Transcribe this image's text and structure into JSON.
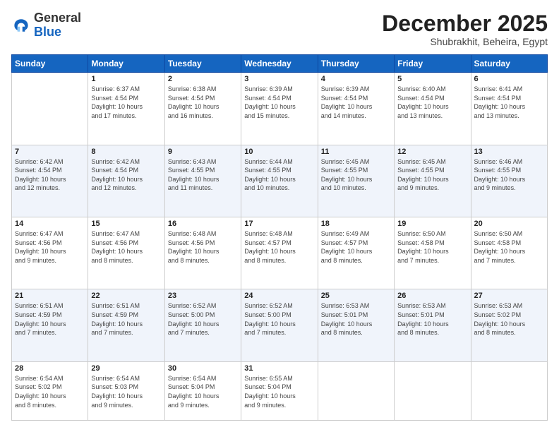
{
  "logo": {
    "general": "General",
    "blue": "Blue"
  },
  "header": {
    "month": "December 2025",
    "location": "Shubrakhit, Beheira, Egypt"
  },
  "weekdays": [
    "Sunday",
    "Monday",
    "Tuesday",
    "Wednesday",
    "Thursday",
    "Friday",
    "Saturday"
  ],
  "weeks": [
    [
      {
        "day": "",
        "info": ""
      },
      {
        "day": "1",
        "info": "Sunrise: 6:37 AM\nSunset: 4:54 PM\nDaylight: 10 hours\nand 17 minutes."
      },
      {
        "day": "2",
        "info": "Sunrise: 6:38 AM\nSunset: 4:54 PM\nDaylight: 10 hours\nand 16 minutes."
      },
      {
        "day": "3",
        "info": "Sunrise: 6:39 AM\nSunset: 4:54 PM\nDaylight: 10 hours\nand 15 minutes."
      },
      {
        "day": "4",
        "info": "Sunrise: 6:39 AM\nSunset: 4:54 PM\nDaylight: 10 hours\nand 14 minutes."
      },
      {
        "day": "5",
        "info": "Sunrise: 6:40 AM\nSunset: 4:54 PM\nDaylight: 10 hours\nand 13 minutes."
      },
      {
        "day": "6",
        "info": "Sunrise: 6:41 AM\nSunset: 4:54 PM\nDaylight: 10 hours\nand 13 minutes."
      }
    ],
    [
      {
        "day": "7",
        "info": "Sunrise: 6:42 AM\nSunset: 4:54 PM\nDaylight: 10 hours\nand 12 minutes."
      },
      {
        "day": "8",
        "info": "Sunrise: 6:42 AM\nSunset: 4:54 PM\nDaylight: 10 hours\nand 12 minutes."
      },
      {
        "day": "9",
        "info": "Sunrise: 6:43 AM\nSunset: 4:55 PM\nDaylight: 10 hours\nand 11 minutes."
      },
      {
        "day": "10",
        "info": "Sunrise: 6:44 AM\nSunset: 4:55 PM\nDaylight: 10 hours\nand 10 minutes."
      },
      {
        "day": "11",
        "info": "Sunrise: 6:45 AM\nSunset: 4:55 PM\nDaylight: 10 hours\nand 10 minutes."
      },
      {
        "day": "12",
        "info": "Sunrise: 6:45 AM\nSunset: 4:55 PM\nDaylight: 10 hours\nand 9 minutes."
      },
      {
        "day": "13",
        "info": "Sunrise: 6:46 AM\nSunset: 4:55 PM\nDaylight: 10 hours\nand 9 minutes."
      }
    ],
    [
      {
        "day": "14",
        "info": "Sunrise: 6:47 AM\nSunset: 4:56 PM\nDaylight: 10 hours\nand 9 minutes."
      },
      {
        "day": "15",
        "info": "Sunrise: 6:47 AM\nSunset: 4:56 PM\nDaylight: 10 hours\nand 8 minutes."
      },
      {
        "day": "16",
        "info": "Sunrise: 6:48 AM\nSunset: 4:56 PM\nDaylight: 10 hours\nand 8 minutes."
      },
      {
        "day": "17",
        "info": "Sunrise: 6:48 AM\nSunset: 4:57 PM\nDaylight: 10 hours\nand 8 minutes."
      },
      {
        "day": "18",
        "info": "Sunrise: 6:49 AM\nSunset: 4:57 PM\nDaylight: 10 hours\nand 8 minutes."
      },
      {
        "day": "19",
        "info": "Sunrise: 6:50 AM\nSunset: 4:58 PM\nDaylight: 10 hours\nand 7 minutes."
      },
      {
        "day": "20",
        "info": "Sunrise: 6:50 AM\nSunset: 4:58 PM\nDaylight: 10 hours\nand 7 minutes."
      }
    ],
    [
      {
        "day": "21",
        "info": "Sunrise: 6:51 AM\nSunset: 4:59 PM\nDaylight: 10 hours\nand 7 minutes."
      },
      {
        "day": "22",
        "info": "Sunrise: 6:51 AM\nSunset: 4:59 PM\nDaylight: 10 hours\nand 7 minutes."
      },
      {
        "day": "23",
        "info": "Sunrise: 6:52 AM\nSunset: 5:00 PM\nDaylight: 10 hours\nand 7 minutes."
      },
      {
        "day": "24",
        "info": "Sunrise: 6:52 AM\nSunset: 5:00 PM\nDaylight: 10 hours\nand 7 minutes."
      },
      {
        "day": "25",
        "info": "Sunrise: 6:53 AM\nSunset: 5:01 PM\nDaylight: 10 hours\nand 8 minutes."
      },
      {
        "day": "26",
        "info": "Sunrise: 6:53 AM\nSunset: 5:01 PM\nDaylight: 10 hours\nand 8 minutes."
      },
      {
        "day": "27",
        "info": "Sunrise: 6:53 AM\nSunset: 5:02 PM\nDaylight: 10 hours\nand 8 minutes."
      }
    ],
    [
      {
        "day": "28",
        "info": "Sunrise: 6:54 AM\nSunset: 5:02 PM\nDaylight: 10 hours\nand 8 minutes."
      },
      {
        "day": "29",
        "info": "Sunrise: 6:54 AM\nSunset: 5:03 PM\nDaylight: 10 hours\nand 9 minutes."
      },
      {
        "day": "30",
        "info": "Sunrise: 6:54 AM\nSunset: 5:04 PM\nDaylight: 10 hours\nand 9 minutes."
      },
      {
        "day": "31",
        "info": "Sunrise: 6:55 AM\nSunset: 5:04 PM\nDaylight: 10 hours\nand 9 minutes."
      },
      {
        "day": "",
        "info": ""
      },
      {
        "day": "",
        "info": ""
      },
      {
        "day": "",
        "info": ""
      }
    ]
  ]
}
